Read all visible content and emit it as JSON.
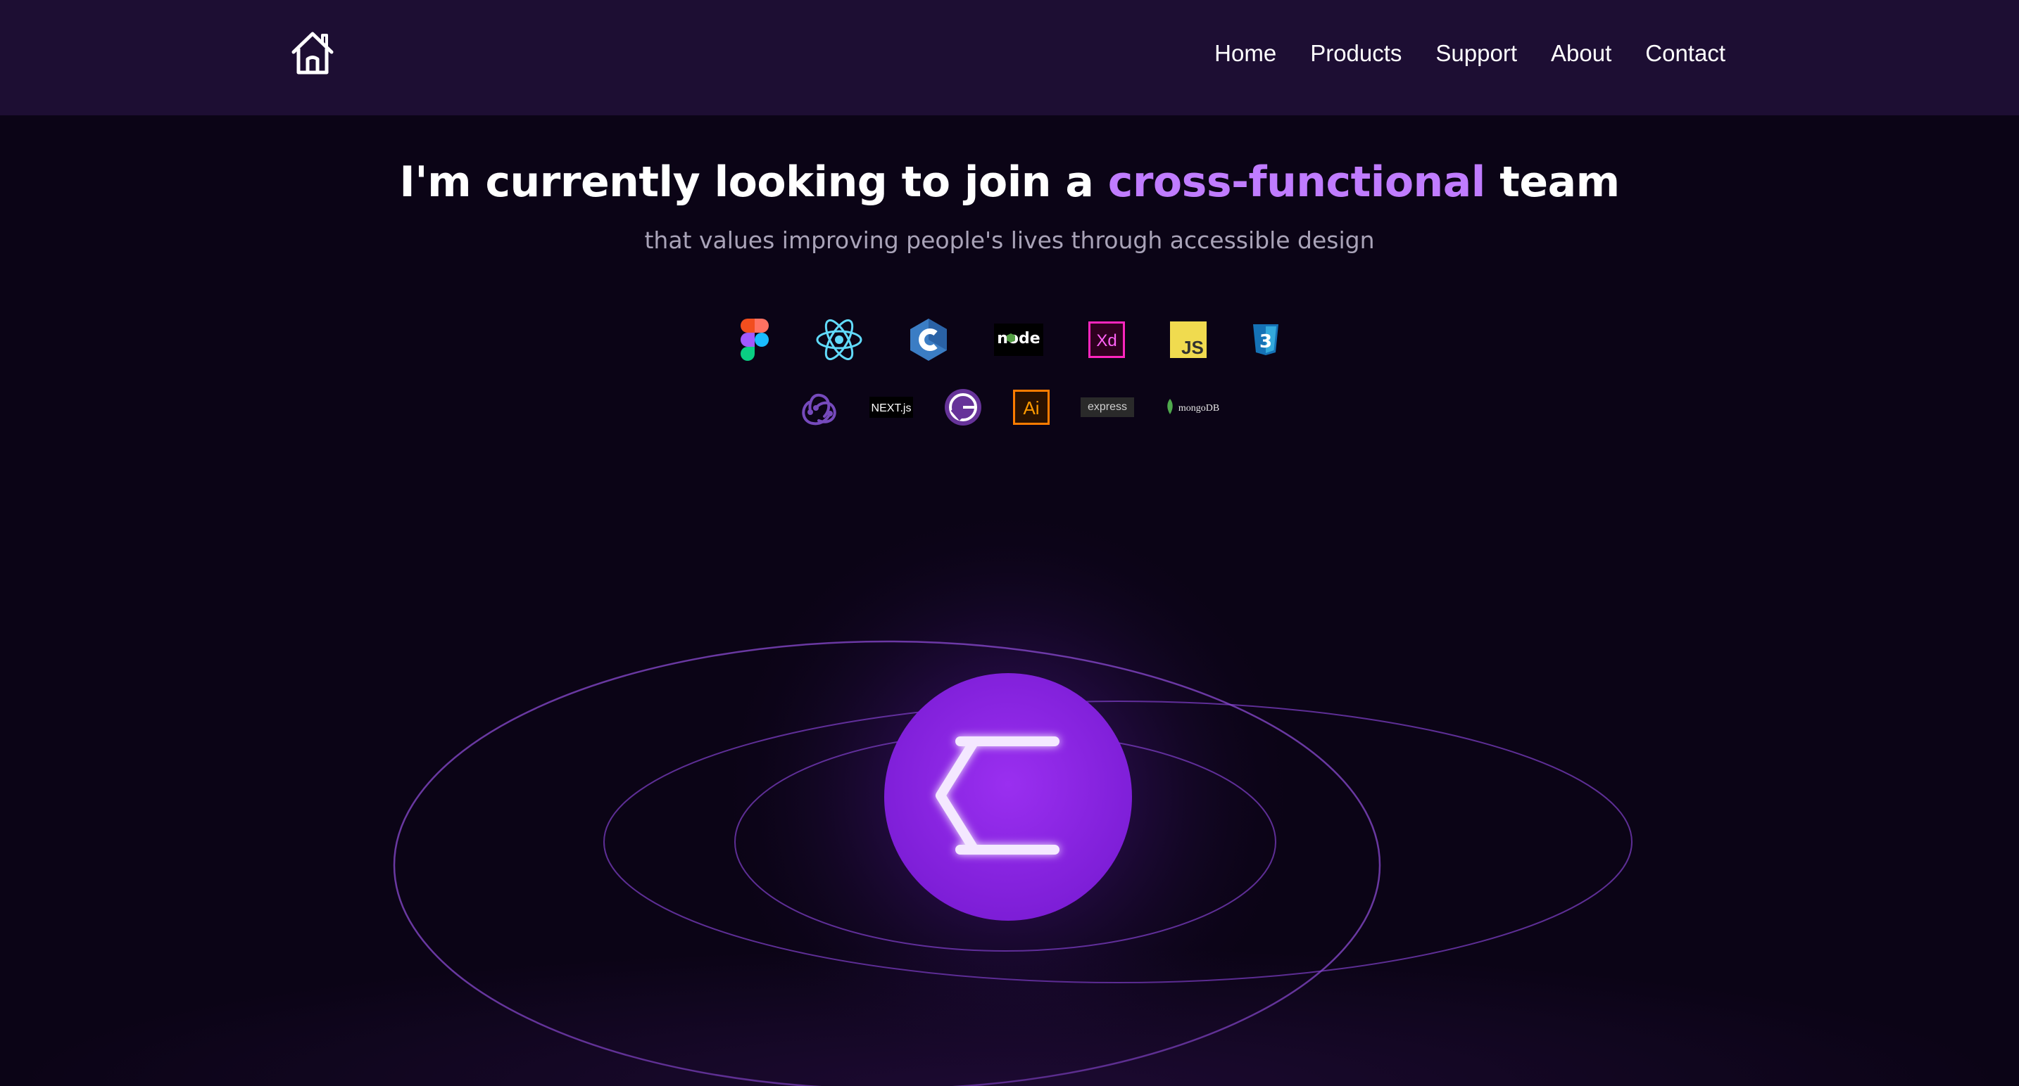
{
  "nav": {
    "home_icon": "house-icon",
    "links": [
      "Home",
      "Products",
      "Support",
      "About",
      "Contact"
    ]
  },
  "hero": {
    "headline_before": "I'm currently looking to join a",
    "headline_accent": "cross-functional",
    "headline_after": "team",
    "subline": "that values improving people's lives through accessible design"
  },
  "tech_icons": {
    "row1": [
      "figma-icon",
      "react-icon",
      "c-icon",
      "nodejs-icon",
      "adobe-xd-icon",
      "javascript-icon",
      "css3-icon"
    ],
    "row2": [
      "redux-icon",
      "nextjs-icon",
      "gatsby-icon",
      "adobe-illustrator-icon",
      "express-icon",
      "mongodb-icon"
    ],
    "labels": {
      "nodejs": "node",
      "xd": "Xd",
      "js": "JS",
      "css": "3",
      "next": "NEXT.js",
      "ai": "Ai",
      "express": "express",
      "mongodb": "mongoDB"
    }
  },
  "logo": {
    "icon": "sigma-logo-icon"
  },
  "colors": {
    "background": "#0b0416",
    "navbar": "#1d0e33",
    "accent": "#c07cff",
    "orb": "#8a22e0",
    "ring": "#7a3cc0",
    "subtext": "#a9a3b8"
  }
}
